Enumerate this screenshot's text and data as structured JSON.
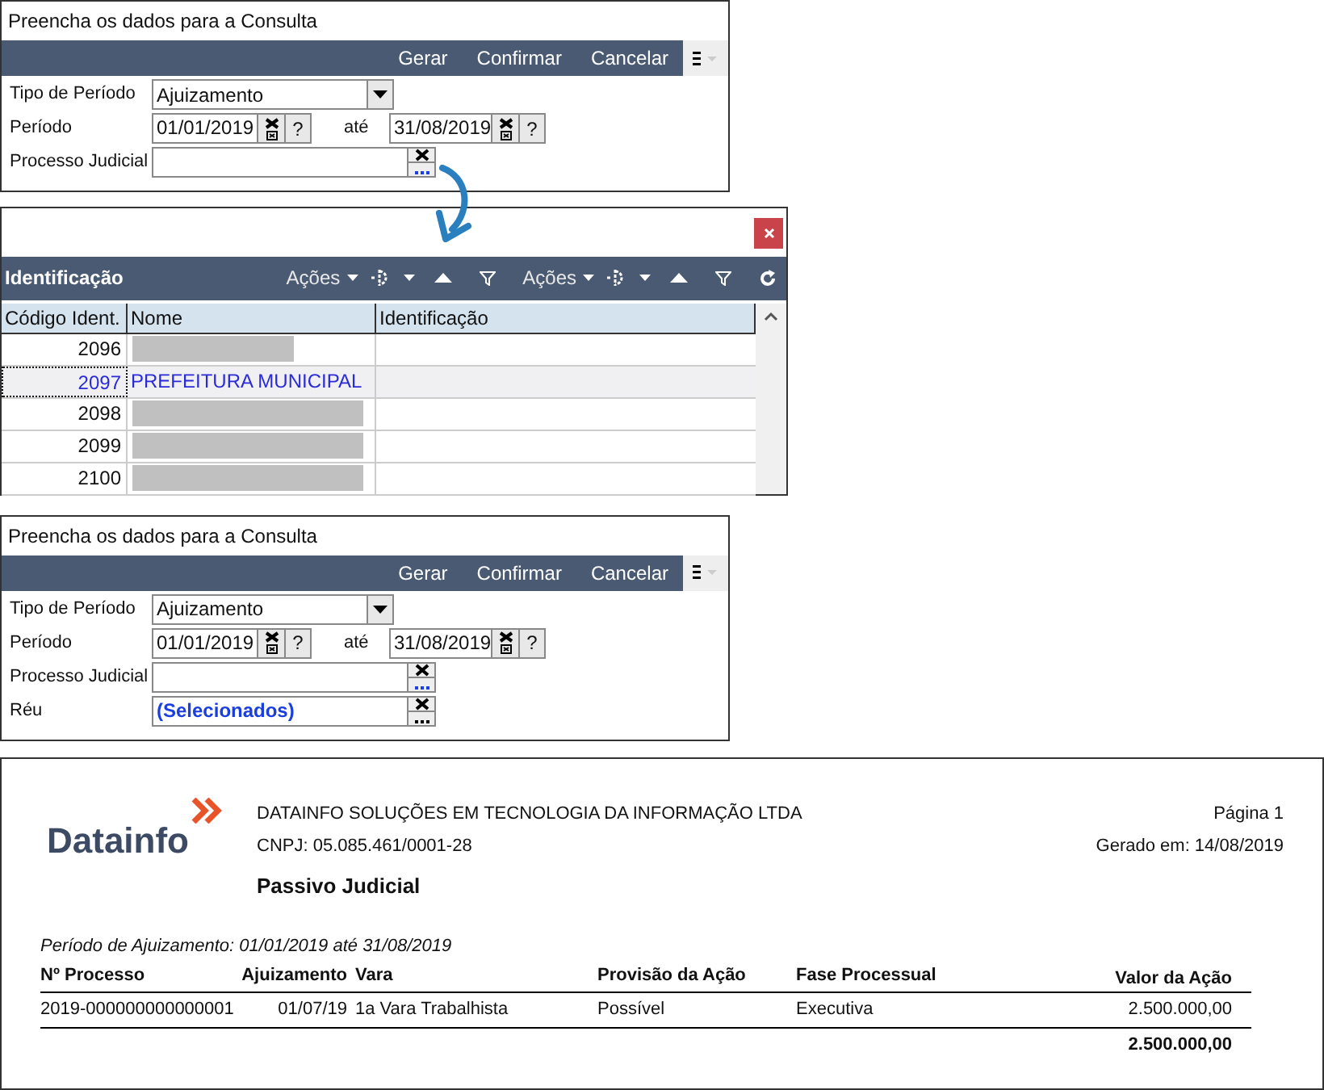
{
  "dialog_first": {
    "title": "Preencha os dados para a Consulta",
    "toolbar": [
      "Gerar",
      "Confirmar",
      "Cancelar"
    ],
    "fields": [
      {
        "kind": "select",
        "label": "Tipo de Período",
        "value": "Ajuizamento"
      },
      {
        "kind": "date_range",
        "label": "Período",
        "from": "01/01/2019",
        "help": "?",
        "separator": "até",
        "to": "31/08/2019",
        "help_to": "?"
      },
      {
        "kind": "lookup",
        "label": "Processo Judicial"
      }
    ]
  },
  "lookup_window": {
    "title": "Identificação",
    "actions": [
      "Ações",
      "Ações"
    ],
    "columns": [
      "Código Ident.",
      "Nome",
      "Identificação"
    ],
    "rows": [
      {
        "code": "2096",
        "name": "",
        "redacted": true,
        "selected": false
      },
      {
        "code": "2097",
        "name": "PREFEITURA MUNICIPAL",
        "redacted": false,
        "selected": true
      },
      {
        "code": "2098",
        "name": "",
        "redacted": true,
        "selected": false
      },
      {
        "code": "2099",
        "name": "",
        "redacted": true,
        "selected": false
      },
      {
        "code": "2100",
        "name": "",
        "redacted": true,
        "selected": false
      }
    ]
  },
  "dialog_second": {
    "title": "Preencha os dados para a Consulta",
    "toolbar": [
      "Gerar",
      "Confirmar",
      "Cancelar"
    ],
    "fields": [
      {
        "kind": "select",
        "label": "Tipo de Período",
        "value": "Ajuizamento"
      },
      {
        "kind": "date_range",
        "label": "Período",
        "from": "01/01/2019",
        "help": "?",
        "separator": "até",
        "to": "31/08/2019",
        "help_to": "?"
      },
      {
        "kind": "lookup",
        "label": "Processo Judicial"
      },
      {
        "kind": "lookup",
        "label": "Réu",
        "value": "(Selecionados)"
      }
    ]
  },
  "report": {
    "logo": "Datainfo",
    "company": "DATAINFO SOLUÇÕES EM TECNOLOGIA DA INFORMAÇÃO LTDA",
    "cnpj": "CNPJ: 05.085.461/0001-28",
    "title": "Passivo Judicial",
    "page": "Página 1",
    "generated": "Gerado em: 14/08/2019",
    "period": "Período de Ajuizamento: 01/01/2019 até 31/08/2019",
    "columns": [
      "Nº Processo",
      "Ajuizamento",
      "Vara",
      "Provisão da Ação",
      "Fase Processual",
      "Valor da Ação"
    ],
    "rows": [
      [
        "2019-000000000000001",
        "01/07/19",
        "1a Vara Trabalhista",
        "Possível",
        "Executiva",
        "2.500.000,00"
      ]
    ],
    "total": "2.500.000,00"
  }
}
